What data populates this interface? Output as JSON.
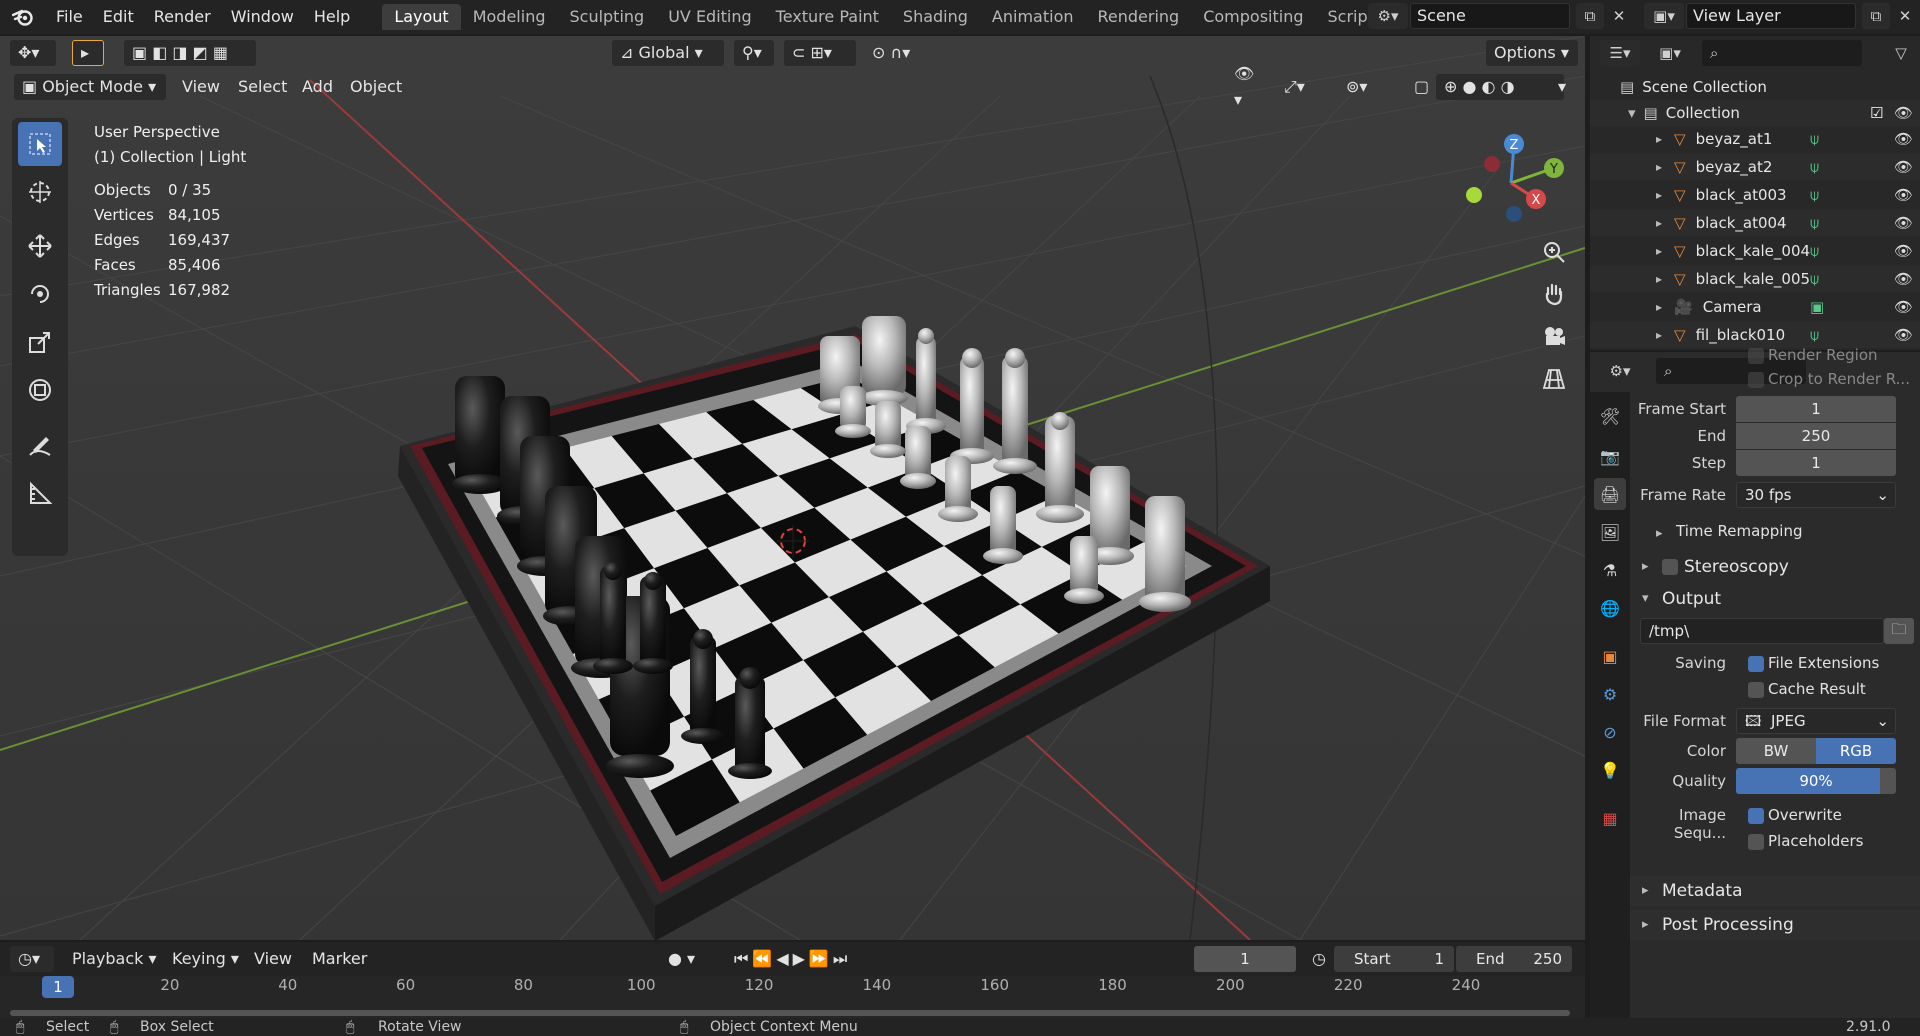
{
  "menu": {
    "items": [
      "File",
      "Edit",
      "Render",
      "Window",
      "Help"
    ]
  },
  "workspaces": {
    "tabs": [
      "Layout",
      "Modeling",
      "Sculpting",
      "UV Editing",
      "Texture Paint",
      "Shading",
      "Animation",
      "Rendering",
      "Compositing",
      "Scripting"
    ],
    "active": "Layout"
  },
  "scene": {
    "name": "Scene"
  },
  "view_layer": {
    "name": "View Layer"
  },
  "viewport": {
    "mode": "Object Mode",
    "menus": [
      "View",
      "Select",
      "Add",
      "Object"
    ],
    "orientation": "Global",
    "options_label": "Options",
    "perspective": "User Perspective",
    "collection_info": "(1) Collection | Light",
    "stats": [
      {
        "label": "Objects",
        "value": "0 / 35"
      },
      {
        "label": "Vertices",
        "value": "84,105"
      },
      {
        "label": "Edges",
        "value": "169,437"
      },
      {
        "label": "Faces",
        "value": "85,406"
      },
      {
        "label": "Triangles",
        "value": "167,982"
      }
    ],
    "gizmo": {
      "z": "Z",
      "y": "Y",
      "x": "X"
    }
  },
  "outliner": {
    "scene_collection": "Scene Collection",
    "collection": "Collection",
    "items": [
      "beyaz_at1",
      "beyaz_at2",
      "black_at003",
      "black_at004",
      "black_kale_004",
      "black_kale_005",
      "Camera",
      "fil_black010"
    ]
  },
  "properties": {
    "render_region": "Render Region",
    "crop": "Crop to Render R...",
    "frame_start_label": "Frame Start",
    "frame_start": "1",
    "end_label": "End",
    "end": "250",
    "step_label": "Step",
    "step": "1",
    "frame_rate_label": "Frame Rate",
    "frame_rate": "30 fps",
    "time_remapping": "Time Remapping",
    "stereoscopy": "Stereoscopy",
    "output": "Output",
    "path": "/tmp\\",
    "saving_label": "Saving",
    "file_extensions": "File Extensions",
    "cache_result": "Cache Result",
    "file_format_label": "File Format",
    "file_format": "JPEG",
    "color_label": "Color",
    "color_bw": "BW",
    "color_rgb": "RGB",
    "quality_label": "Quality",
    "quality": "90%",
    "quality_value": 0.9,
    "image_seq_label": "Image Sequ...",
    "overwrite": "Overwrite",
    "placeholders": "Placeholders",
    "metadata": "Metadata",
    "post_processing": "Post Processing"
  },
  "timeline": {
    "menus": [
      "Playback",
      "Keying",
      "View",
      "Marker"
    ],
    "current_frame": "1",
    "start_label": "Start",
    "start": "1",
    "end_label": "End",
    "end": "250",
    "ruler_ticks": [
      "1",
      "20",
      "40",
      "60",
      "80",
      "100",
      "120",
      "140",
      "160",
      "180",
      "200",
      "220",
      "240"
    ],
    "ruler_current": "1"
  },
  "statusbar": {
    "select": "Select",
    "box_select": "Box Select",
    "rotate_view": "Rotate View",
    "context_menu": "Object Context Menu",
    "version": "2.91.0"
  },
  "colors": {
    "accent": "#4772b3",
    "bg": "#3a3a3a",
    "panel": "#2b2b2b",
    "x_axis": "#d44a4a",
    "y_axis": "#7fb53a",
    "z_axis": "#4a8ad4"
  }
}
